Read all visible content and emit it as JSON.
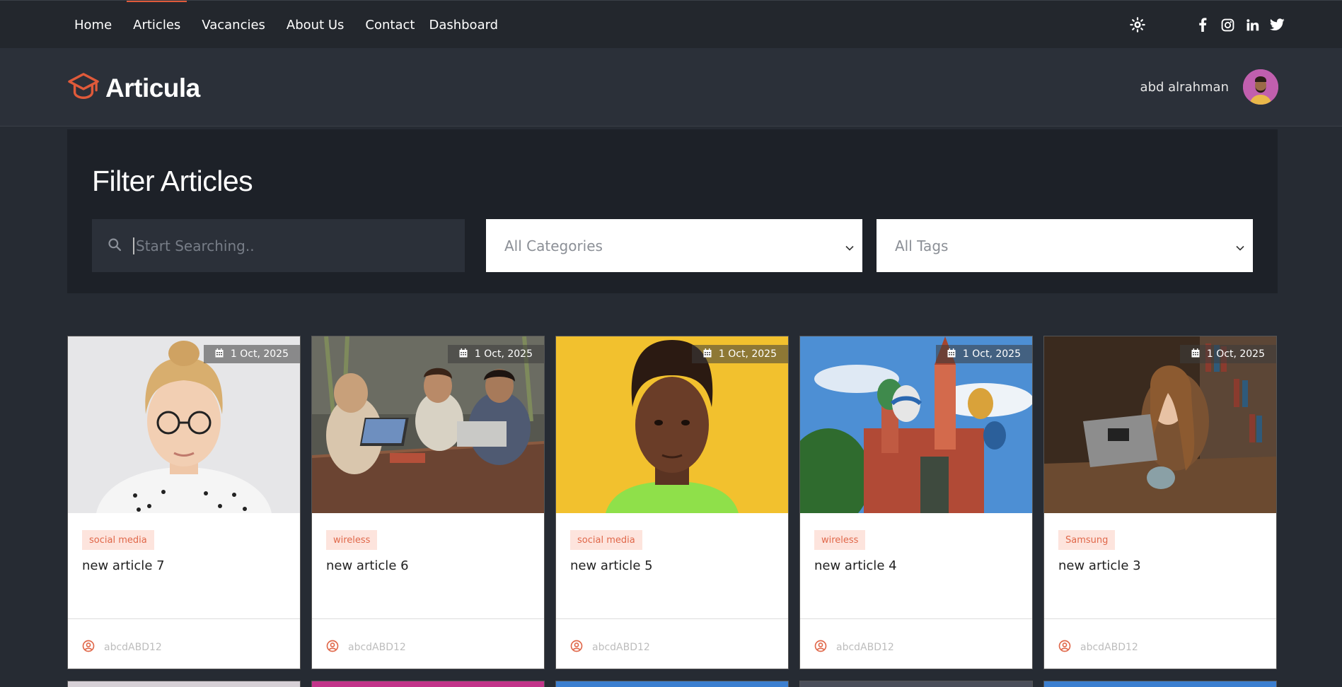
{
  "topnav": {
    "links": [
      "Home",
      "Articles",
      "Vacancies",
      "About Us",
      "Contact",
      "Dashboard"
    ],
    "active": "Articles",
    "icons": [
      "sun-icon",
      "facebook-icon",
      "instagram-icon",
      "linkedin-icon",
      "twitter-icon"
    ]
  },
  "header": {
    "brand": "Articula",
    "user_name": "abd alrahman"
  },
  "filter": {
    "title": "Filter Articles",
    "search_placeholder": "Start Searching..",
    "category_select": "All Categories",
    "tag_select": "All Tags"
  },
  "articles": [
    {
      "date": "1 Oct, 2025",
      "tag": "social media",
      "title": "new article 7",
      "author": "abcdABD12"
    },
    {
      "date": "1 Oct, 2025",
      "tag": "wireless",
      "title": "new article 6",
      "author": "abcdABD12"
    },
    {
      "date": "1 Oct, 2025",
      "tag": "social media",
      "title": "new article 5",
      "author": "abcdABD12"
    },
    {
      "date": "1 Oct, 2025",
      "tag": "wireless",
      "title": "new article 4",
      "author": "abcdABD12"
    },
    {
      "date": "1 Oct, 2025",
      "tag": "Samsung",
      "title": "new article 3",
      "author": "abcdABD12"
    }
  ],
  "colors": {
    "accent": "#e05a3a",
    "page_bg": "#262b33",
    "tag_bg": "#fde4dd",
    "tag_text": "#e0684a"
  }
}
